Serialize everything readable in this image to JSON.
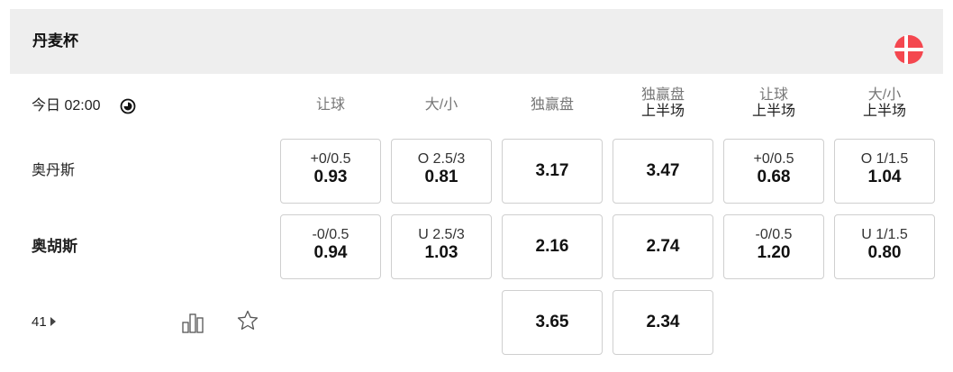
{
  "league": {
    "title": "丹麦杯",
    "flag_icon": "denmark-flag-icon",
    "flag_color": "#f4474f"
  },
  "match": {
    "time": "今日 02:00",
    "clock_icon": "clock-icon"
  },
  "columns": [
    {
      "label": "让球",
      "sub": ""
    },
    {
      "label": "大/小",
      "sub": ""
    },
    {
      "label": "独赢盘",
      "sub": ""
    },
    {
      "label": "独赢盘",
      "sub": "上半场"
    },
    {
      "label": "让球",
      "sub": "上半场"
    },
    {
      "label": "大/小",
      "sub": "上半场"
    }
  ],
  "teams": {
    "home": "奥丹斯",
    "away": "奥胡斯"
  },
  "odds": {
    "home": [
      {
        "line": "+0/0.5",
        "odds": "0.93"
      },
      {
        "line": "O 2.5/3",
        "odds": "0.81"
      },
      {
        "line": "",
        "odds": "3.17"
      },
      {
        "line": "",
        "odds": "3.47"
      },
      {
        "line": "+0/0.5",
        "odds": "0.68"
      },
      {
        "line": "O 1/1.5",
        "odds": "1.04"
      }
    ],
    "away": [
      {
        "line": "-0/0.5",
        "odds": "0.94"
      },
      {
        "line": "U 2.5/3",
        "odds": "1.03"
      },
      {
        "line": "",
        "odds": "2.16"
      },
      {
        "line": "",
        "odds": "2.74"
      },
      {
        "line": "-0/0.5",
        "odds": "1.20"
      },
      {
        "line": "U 1/1.5",
        "odds": "0.80"
      }
    ],
    "draw": [
      {
        "line": "",
        "odds": "3.65"
      },
      {
        "line": "",
        "odds": "2.34"
      }
    ]
  },
  "footer": {
    "more_count": "41",
    "stats_icon": "bar-chart-icon",
    "favorite_icon": "star-outline-icon"
  }
}
